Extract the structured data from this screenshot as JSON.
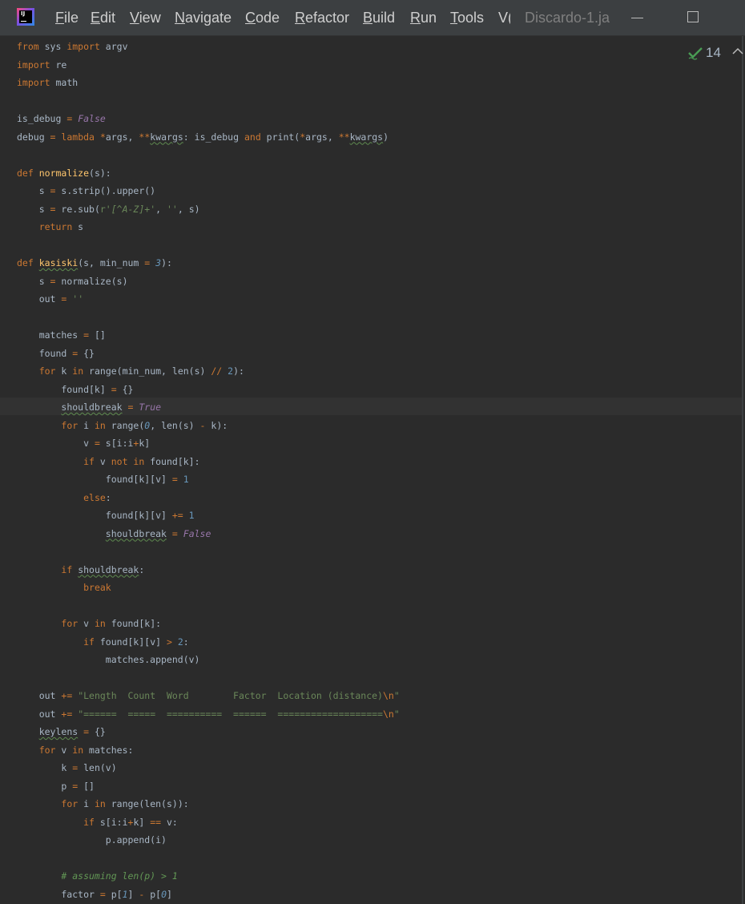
{
  "titlebar": {
    "app_logo_text": "IJ",
    "menu": [
      {
        "mnemonic": "F",
        "rest": "ile"
      },
      {
        "mnemonic": "E",
        "rest": "dit"
      },
      {
        "mnemonic": "V",
        "rest": "iew"
      },
      {
        "mnemonic": "N",
        "rest": "avigate"
      },
      {
        "mnemonic": "C",
        "rest": "ode"
      },
      {
        "mnemonic": "R",
        "rest": "efactor"
      },
      {
        "mnemonic": "B",
        "rest": "uild"
      },
      {
        "mnemonic": "R",
        "rest": "un"
      },
      {
        "mnemonic": "T",
        "rest": "ools"
      },
      {
        "mnemonic": "",
        "rest": "V("
      }
    ],
    "window_title": "Discardo-1.ja",
    "minimize_icon": "minimize-icon",
    "maximize_icon": "maximize-icon"
  },
  "editor": {
    "inspection_count": "14",
    "inspection_icon": "check-icon",
    "nav_icon": "chevron-up-icon",
    "accent_color": "#cc7832",
    "string_color": "#6a8759",
    "number_color": "#6897bb",
    "constant_color": "#9876aa",
    "function_color": "#ffc66d",
    "text_color": "#a9b7c6",
    "lines": [
      [
        [
          "kw",
          "from"
        ],
        [
          "id",
          " sys "
        ],
        [
          "kw",
          "import"
        ],
        [
          "id",
          " argv"
        ]
      ],
      [
        [
          "kw",
          "import"
        ],
        [
          "id",
          " re"
        ]
      ],
      [
        [
          "kw",
          "import"
        ],
        [
          "id",
          " math"
        ]
      ],
      [],
      [
        [
          "id",
          "is_debug "
        ],
        [
          "kw",
          "="
        ],
        [
          "id",
          " "
        ],
        [
          "const",
          "False"
        ]
      ],
      [
        [
          "id",
          "debug "
        ],
        [
          "kw",
          "="
        ],
        [
          "id",
          " "
        ],
        [
          "kw",
          "lambda"
        ],
        [
          "id",
          " "
        ],
        [
          "kw",
          "*"
        ],
        [
          "id",
          "args, "
        ],
        [
          "kw",
          "**"
        ],
        [
          "typo",
          "kwargs"
        ],
        [
          "id",
          ": is_debug "
        ],
        [
          "kw",
          "and"
        ],
        [
          "id",
          " print("
        ],
        [
          "kw",
          "*"
        ],
        [
          "id",
          "args, "
        ],
        [
          "kw",
          "**"
        ],
        [
          "typo",
          "kwargs"
        ],
        [
          "id",
          ")"
        ]
      ],
      [],
      [
        [
          "kw",
          "def"
        ],
        [
          "id",
          " "
        ],
        [
          "fn",
          "normalize"
        ],
        [
          "id",
          "(s):"
        ]
      ],
      [
        [
          "id",
          "    s "
        ],
        [
          "kw",
          "="
        ],
        [
          "id",
          " s.strip().upper()"
        ]
      ],
      [
        [
          "id",
          "    s "
        ],
        [
          "kw",
          "="
        ],
        [
          "id",
          " re.sub("
        ],
        [
          "str",
          "r'"
        ],
        [
          "re",
          "[^A-Z]+"
        ],
        [
          "str",
          "'"
        ],
        [
          "id",
          ", "
        ],
        [
          "str",
          "''"
        ],
        [
          "id",
          ", s)"
        ]
      ],
      [
        [
          "id",
          "    "
        ],
        [
          "kw",
          "return"
        ],
        [
          "id",
          " s"
        ]
      ],
      [],
      [
        [
          "kw",
          "def"
        ],
        [
          "id",
          " "
        ],
        [
          "fntypo",
          "kasiski"
        ],
        [
          "id",
          "(s, min_num "
        ],
        [
          "kw",
          "="
        ],
        [
          "id",
          " "
        ],
        [
          "numi",
          "3"
        ],
        [
          "id",
          "):"
        ]
      ],
      [
        [
          "id",
          "    s "
        ],
        [
          "kw",
          "="
        ],
        [
          "id",
          " normalize(s)"
        ]
      ],
      [
        [
          "id",
          "    out "
        ],
        [
          "kw",
          "="
        ],
        [
          "id",
          " "
        ],
        [
          "str",
          "''"
        ]
      ],
      [],
      [
        [
          "id",
          "    matches "
        ],
        [
          "kw",
          "="
        ],
        [
          "id",
          " []"
        ]
      ],
      [
        [
          "id",
          "    found "
        ],
        [
          "kw",
          "="
        ],
        [
          "id",
          " {}"
        ]
      ],
      [
        [
          "id",
          "    "
        ],
        [
          "kw",
          "for"
        ],
        [
          "id",
          " k "
        ],
        [
          "kw",
          "in"
        ],
        [
          "id",
          " range(min_num, len(s) "
        ],
        [
          "kw",
          "//"
        ],
        [
          "id",
          " "
        ],
        [
          "num",
          "2"
        ],
        [
          "id",
          "):"
        ]
      ],
      [
        [
          "id",
          "        found[k] "
        ],
        [
          "kw",
          "="
        ],
        [
          "id",
          " {}"
        ]
      ],
      [
        [
          "id",
          "        "
        ],
        [
          "typo",
          "shouldbreak"
        ],
        [
          "id",
          " "
        ],
        [
          "kw",
          "="
        ],
        [
          "id",
          " "
        ],
        [
          "const",
          "True"
        ]
      ],
      [
        [
          "id",
          "        "
        ],
        [
          "kw",
          "for"
        ],
        [
          "id",
          " i "
        ],
        [
          "kw",
          "in"
        ],
        [
          "id",
          " range("
        ],
        [
          "numi",
          "0"
        ],
        [
          "id",
          ", len(s) "
        ],
        [
          "kw",
          "-"
        ],
        [
          "id",
          " k):"
        ]
      ],
      [
        [
          "id",
          "            v "
        ],
        [
          "kw",
          "="
        ],
        [
          "id",
          " s[i:i"
        ],
        [
          "kw",
          "+"
        ],
        [
          "id",
          "k]"
        ]
      ],
      [
        [
          "id",
          "            "
        ],
        [
          "kw",
          "if"
        ],
        [
          "id",
          " v "
        ],
        [
          "kw",
          "not in"
        ],
        [
          "id",
          " found[k]:"
        ]
      ],
      [
        [
          "id",
          "                found[k][v] "
        ],
        [
          "kw",
          "="
        ],
        [
          "id",
          " "
        ],
        [
          "num",
          "1"
        ]
      ],
      [
        [
          "id",
          "            "
        ],
        [
          "kw",
          "else"
        ],
        [
          "id",
          ":"
        ]
      ],
      [
        [
          "id",
          "                found[k][v] "
        ],
        [
          "kw",
          "+="
        ],
        [
          "id",
          " "
        ],
        [
          "num",
          "1"
        ]
      ],
      [
        [
          "id",
          "                "
        ],
        [
          "typo",
          "shouldbreak"
        ],
        [
          "id",
          " "
        ],
        [
          "kw",
          "="
        ],
        [
          "id",
          " "
        ],
        [
          "const",
          "False"
        ]
      ],
      [],
      [
        [
          "id",
          "        "
        ],
        [
          "kw",
          "if"
        ],
        [
          "id",
          " "
        ],
        [
          "typo",
          "shouldbreak"
        ],
        [
          "id",
          ":"
        ]
      ],
      [
        [
          "id",
          "            "
        ],
        [
          "kw",
          "break"
        ]
      ],
      [],
      [
        [
          "id",
          "        "
        ],
        [
          "kw",
          "for"
        ],
        [
          "id",
          " v "
        ],
        [
          "kw",
          "in"
        ],
        [
          "id",
          " found[k]:"
        ]
      ],
      [
        [
          "id",
          "            "
        ],
        [
          "kw",
          "if"
        ],
        [
          "id",
          " found[k][v] "
        ],
        [
          "kw",
          ">"
        ],
        [
          "id",
          " "
        ],
        [
          "num",
          "2"
        ],
        [
          "id",
          ":"
        ]
      ],
      [
        [
          "id",
          "                matches.append(v)"
        ]
      ],
      [],
      [
        [
          "id",
          "    out "
        ],
        [
          "kw",
          "+="
        ],
        [
          "id",
          " "
        ],
        [
          "str",
          "\"Length  Count  Word        Factor  Location (distance)"
        ],
        [
          "esc",
          "\\n"
        ],
        [
          "str",
          "\""
        ]
      ],
      [
        [
          "id",
          "    out "
        ],
        [
          "kw",
          "+="
        ],
        [
          "id",
          " "
        ],
        [
          "str",
          "\"======  =====  ==========  ======  ==================="
        ],
        [
          "esc",
          "\\n"
        ],
        [
          "str",
          "\""
        ]
      ],
      [
        [
          "id",
          "    "
        ],
        [
          "typo",
          "keylens"
        ],
        [
          "id",
          " "
        ],
        [
          "kw",
          "="
        ],
        [
          "id",
          " {}"
        ]
      ],
      [
        [
          "id",
          "    "
        ],
        [
          "kw",
          "for"
        ],
        [
          "id",
          " v "
        ],
        [
          "kw",
          "in"
        ],
        [
          "id",
          " matches:"
        ]
      ],
      [
        [
          "id",
          "        k "
        ],
        [
          "kw",
          "="
        ],
        [
          "id",
          " len(v)"
        ]
      ],
      [
        [
          "id",
          "        p "
        ],
        [
          "kw",
          "="
        ],
        [
          "id",
          " []"
        ]
      ],
      [
        [
          "id",
          "        "
        ],
        [
          "kw",
          "for"
        ],
        [
          "id",
          " i "
        ],
        [
          "kw",
          "in"
        ],
        [
          "id",
          " range(len(s)):"
        ]
      ],
      [
        [
          "id",
          "            "
        ],
        [
          "kw",
          "if"
        ],
        [
          "id",
          " s[i:i"
        ],
        [
          "kw",
          "+"
        ],
        [
          "id",
          "k] "
        ],
        [
          "kw",
          "=="
        ],
        [
          "id",
          " v:"
        ]
      ],
      [
        [
          "id",
          "                p.append(i)"
        ]
      ],
      [],
      [
        [
          "id",
          "        "
        ],
        [
          "cmt",
          "# assuming len(p) > 1"
        ]
      ],
      [
        [
          "id",
          "        factor "
        ],
        [
          "kw",
          "="
        ],
        [
          "id",
          " p["
        ],
        [
          "numi",
          "1"
        ],
        [
          "id",
          "] "
        ],
        [
          "kw",
          "-"
        ],
        [
          "id",
          " p["
        ],
        [
          "numi",
          "0"
        ],
        [
          "id",
          "]"
        ]
      ]
    ]
  }
}
